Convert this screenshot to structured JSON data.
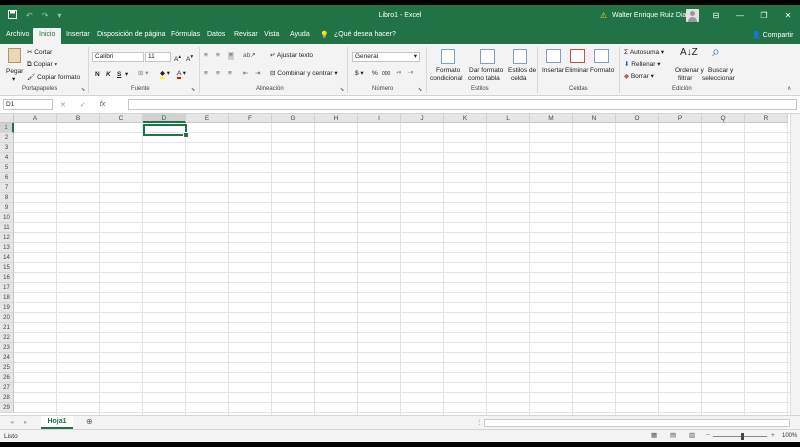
{
  "title": "Libro1  -  Excel",
  "user": "Walter Enrique Ruiz Diaz",
  "window_buttons": [
    "⊟",
    "—",
    "❐",
    "✕"
  ],
  "tabs": [
    {
      "id": "archivo",
      "label": "Archivo"
    },
    {
      "id": "inicio",
      "label": "Inicio"
    },
    {
      "id": "insertar",
      "label": "Insertar"
    },
    {
      "id": "disposicion",
      "label": "Disposición de página"
    },
    {
      "id": "formulas",
      "label": "Fórmulas"
    },
    {
      "id": "datos",
      "label": "Datos"
    },
    {
      "id": "revisar",
      "label": "Revisar"
    },
    {
      "id": "vista",
      "label": "Vista"
    },
    {
      "id": "ayuda",
      "label": "Ayuda"
    }
  ],
  "tell_me": "¿Qué desea hacer?",
  "share": "Compartir",
  "ribbon": {
    "clipboard": {
      "paste": "Pegar",
      "cut": "Cortar",
      "copy": "Copiar",
      "format_painter": "Copiar formato",
      "label": "Portapapeles"
    },
    "font": {
      "name": "Calibri",
      "size": "11",
      "bold": "N",
      "italic": "K",
      "underline": "S",
      "label": "Fuente"
    },
    "alignment": {
      "wrap": "Ajustar texto",
      "merge": "Combinar y centrar",
      "label": "Alineación"
    },
    "number": {
      "format": "General",
      "currency": "$",
      "percent": "%",
      "comma": "000",
      "label": "Número"
    },
    "styles": {
      "conditional_1": "Formato",
      "conditional_2": "condicional",
      "table_1": "Dar formato",
      "table_2": "como tabla",
      "cell_1": "Estilos de",
      "cell_2": "celda",
      "label": "Estilos"
    },
    "cells": {
      "insert": "Insertar",
      "delete": "Eliminar",
      "format": "Formato",
      "label": "Celdas"
    },
    "editing": {
      "autosum": "Autosuma",
      "fill": "Rellenar",
      "clear": "Borrar",
      "sort_1": "Ordenar y",
      "sort_2": "filtrar",
      "find_1": "Buscar y",
      "find_2": "seleccionar",
      "label": "Edición"
    }
  },
  "formula_bar": {
    "name_box": "D1",
    "fx": "fx",
    "value": ""
  },
  "grid": {
    "columns": [
      "A",
      "B",
      "C",
      "D",
      "E",
      "F",
      "G",
      "H",
      "I",
      "J",
      "K",
      "L",
      "M",
      "N",
      "O",
      "P",
      "Q",
      "R"
    ],
    "row_count": 29,
    "selected_column": "D",
    "selected_row": 1
  },
  "sheet_tab": "Hoja1",
  "status": "Listo",
  "zoom": "100%",
  "colors": {
    "accent": "#217346",
    "ribbon_bg": "#f3f3f3"
  }
}
